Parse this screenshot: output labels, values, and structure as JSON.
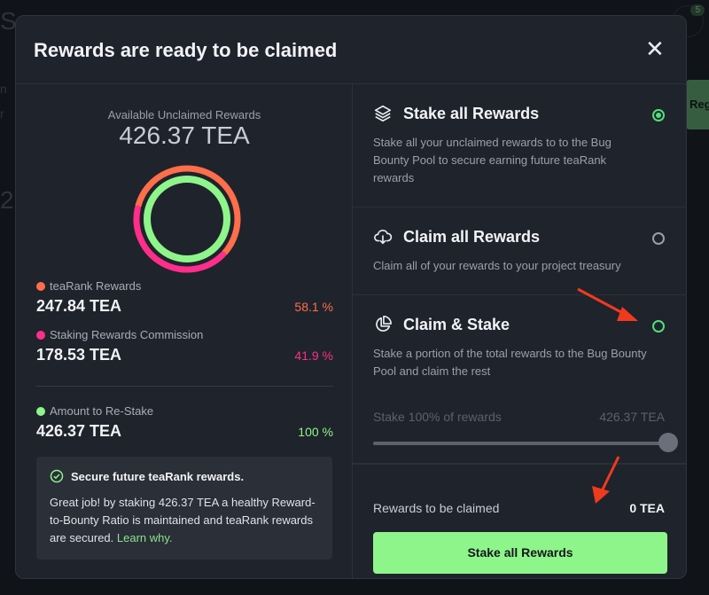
{
  "modal": {
    "title": "Rewards are ready to be claimed",
    "close_label": "✕"
  },
  "summary": {
    "available_label": "Available Unclaimed Rewards",
    "available_value": "426.37 TEA",
    "stats": [
      {
        "label": "teaRank Rewards",
        "value": "247.84 TEA",
        "percent": "58.1 %",
        "color": "#ff6e4a"
      },
      {
        "label": "Staking Rewards Commission",
        "value": "178.53 TEA",
        "percent": "41.9 %",
        "color": "#ff2e8a"
      },
      {
        "label": "Amount to Re-Stake",
        "value": "426.37 TEA",
        "percent": "100 %",
        "color": "#8ef58a"
      }
    ],
    "donut": {
      "segments": [
        {
          "name": "teaRank Rewards",
          "fraction": 0.581,
          "color": "#ff6e4a"
        },
        {
          "name": "Staking Rewards Commission",
          "fraction": 0.419,
          "color": "#ff2e8a"
        }
      ],
      "restake_fraction": 1.0,
      "restake_color": "#8ef58a"
    }
  },
  "info": {
    "title": "Secure future teaRank rewards.",
    "text": "Great job! by staking 426.37 TEA a healthy Reward-to-Bounty Ratio is maintained and teaRank rewards are secured.",
    "link": "Learn why."
  },
  "options": [
    {
      "title": "Stake all Rewards",
      "description": "Stake all your unclaimed rewards to to the Bug Bounty Pool to secure earning future teaRank rewards",
      "icon": "layers-icon",
      "selected": true
    },
    {
      "title": "Claim all Rewards",
      "description": "Claim all of your rewards to your project treasury",
      "icon": "cloud-download-icon",
      "selected": false
    },
    {
      "title": "Claim & Stake",
      "description": "Stake a portion of the total rewards to the Bug Bounty Pool and claim the rest",
      "icon": "pie-chart-icon",
      "selected": false
    }
  ],
  "slider": {
    "label": "Stake 100% of rewards",
    "value_text": "426.37 TEA",
    "fraction": 1.0
  },
  "footer": {
    "claim_label": "Rewards to be claimed",
    "claim_value": "0 TEA",
    "button_label": "Stake all Rewards"
  },
  "colors": {
    "accent_green": "#8ef58a",
    "radio_green": "#4fe07a",
    "annotation_red": "#f03a1e"
  }
}
